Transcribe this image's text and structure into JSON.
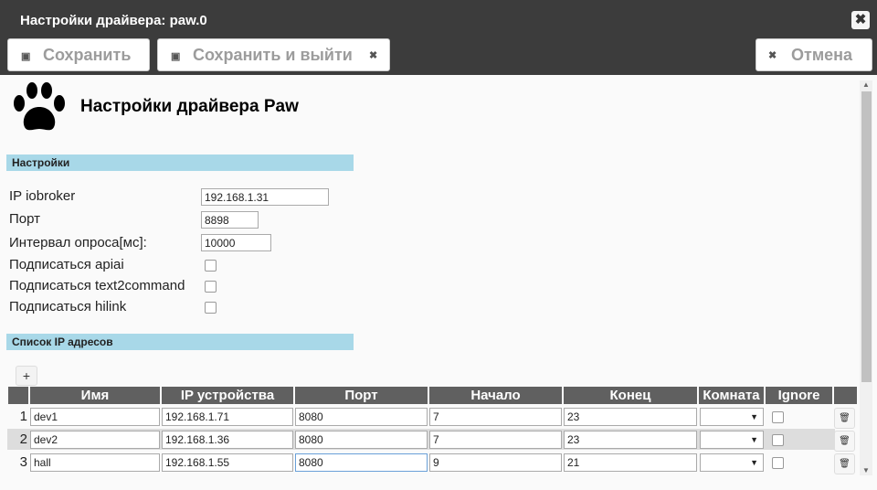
{
  "window": {
    "title": "Настройки драйвера: paw.0",
    "close_glyph": "✖"
  },
  "toolbar": {
    "save_label": "Сохранить",
    "save_exit_label": "Сохранить и выйти",
    "cancel_label": "Отмена",
    "save_icon": "💾",
    "close_small": "✖"
  },
  "page": {
    "title": "Настройки драйвера Paw"
  },
  "sections": {
    "settings": "Настройки",
    "ip_list": "Список IP адресов"
  },
  "fields": {
    "ip_label": "IP iobroker",
    "ip_value": "192.168.1.31",
    "port_label": "Порт",
    "port_value": "8898",
    "interval_label": "Интервал опроса[мс]:",
    "interval_value": "10000",
    "apiai_label": "Подписаться apiai",
    "t2c_label": "Подписаться text2command",
    "hilink_label": "Подписаться hilink"
  },
  "table": {
    "add_glyph": "+",
    "columns": [
      "Имя",
      "IP устройства",
      "Порт",
      "Начало",
      "Конец",
      "Комната",
      "Ignore"
    ],
    "rows": [
      {
        "num": "1",
        "name": "dev1",
        "ip": "192.168.1.71",
        "port": "8080",
        "start": "7",
        "end": "23"
      },
      {
        "num": "2",
        "name": "dev2",
        "ip": "192.168.1.36",
        "port": "8080",
        "start": "7",
        "end": "23"
      },
      {
        "num": "3",
        "name": "hall",
        "ip": "192.168.1.55",
        "port": "8080",
        "start": "9",
        "end": "21"
      }
    ],
    "dropdown_arrow": "▼",
    "delete_glyph": "🗑"
  },
  "colors": {
    "header_bg": "#3c3c3c",
    "section_bg": "#a8d8e8",
    "th_bg": "#606060"
  }
}
